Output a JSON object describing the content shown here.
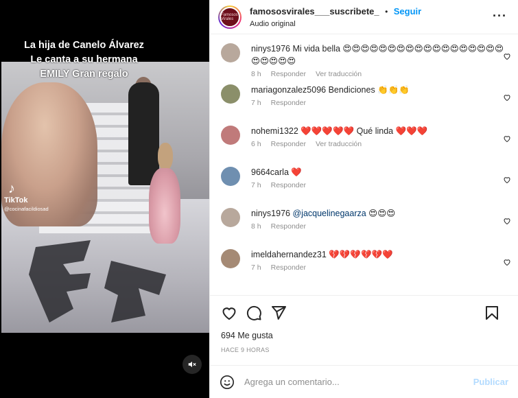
{
  "video": {
    "caption": "La  hija de Canelo Álvarez   Le canta  a su hermana  EMILY   Gran regalo",
    "watermark_brand": "TikTok",
    "watermark_user": "@cocinafacildiosad",
    "mute_icon": "speaker-muted-icon"
  },
  "header": {
    "username": "famososvirales___suscribete_",
    "dot": "•",
    "follow_label": "Seguir",
    "audio_label": "Audio original",
    "avatar_text": "Famosos Virales",
    "more_label": "···"
  },
  "comments": [
    {
      "user": "ninys1976",
      "text": "Mi vida bella 😍😍😍😍😍😍😍😍😍😍😍😍😍😍😍😍😍😍😍😍😍😍😍",
      "time": "8 h",
      "reply": "Responder",
      "translate": "Ver traducción",
      "avatar_color": "#b8a89c"
    },
    {
      "user": "mariagonzalez5096",
      "text": "Bendiciones 👏👏👏",
      "time": "7 h",
      "reply": "Responder",
      "translate": "",
      "avatar_color": "#8b8f6a"
    },
    {
      "user": "nohemi1322",
      "text": "❤️❤️❤️❤️❤️ Qué linda ❤️❤️❤️",
      "time": "6 h",
      "reply": "Responder",
      "translate": "Ver traducción",
      "avatar_color": "#c07a7a"
    },
    {
      "user": "9664carla",
      "text": "❤️",
      "time": "7 h",
      "reply": "Responder",
      "translate": "",
      "avatar_color": "#6f8fb0"
    },
    {
      "user": "ninys1976",
      "mention": "@jacquelinegaarza",
      "text": "😍😍😍",
      "time": "8 h",
      "reply": "Responder",
      "translate": "",
      "avatar_color": "#b8a89c"
    },
    {
      "user": "imeldahernandez31",
      "text": "💔💔💔💔💔❤️",
      "time": "7 h",
      "reply": "Responder",
      "translate": "",
      "avatar_color": "#a58a75"
    }
  ],
  "actions": {
    "like_icon": "heart-icon",
    "comment_icon": "comment-icon",
    "share_icon": "send-icon",
    "save_icon": "bookmark-icon"
  },
  "likes": "694 Me gusta",
  "timestamp": "HACE 9 HORAS",
  "compose": {
    "placeholder": "Agrega un comentario...",
    "post_label": "Publicar",
    "emoji_icon": "smiley-icon"
  },
  "colors": {
    "accent": "#0095f6",
    "post_disabled": "#b3dbff",
    "meta": "#8e8e8e",
    "border": "#efefef"
  }
}
